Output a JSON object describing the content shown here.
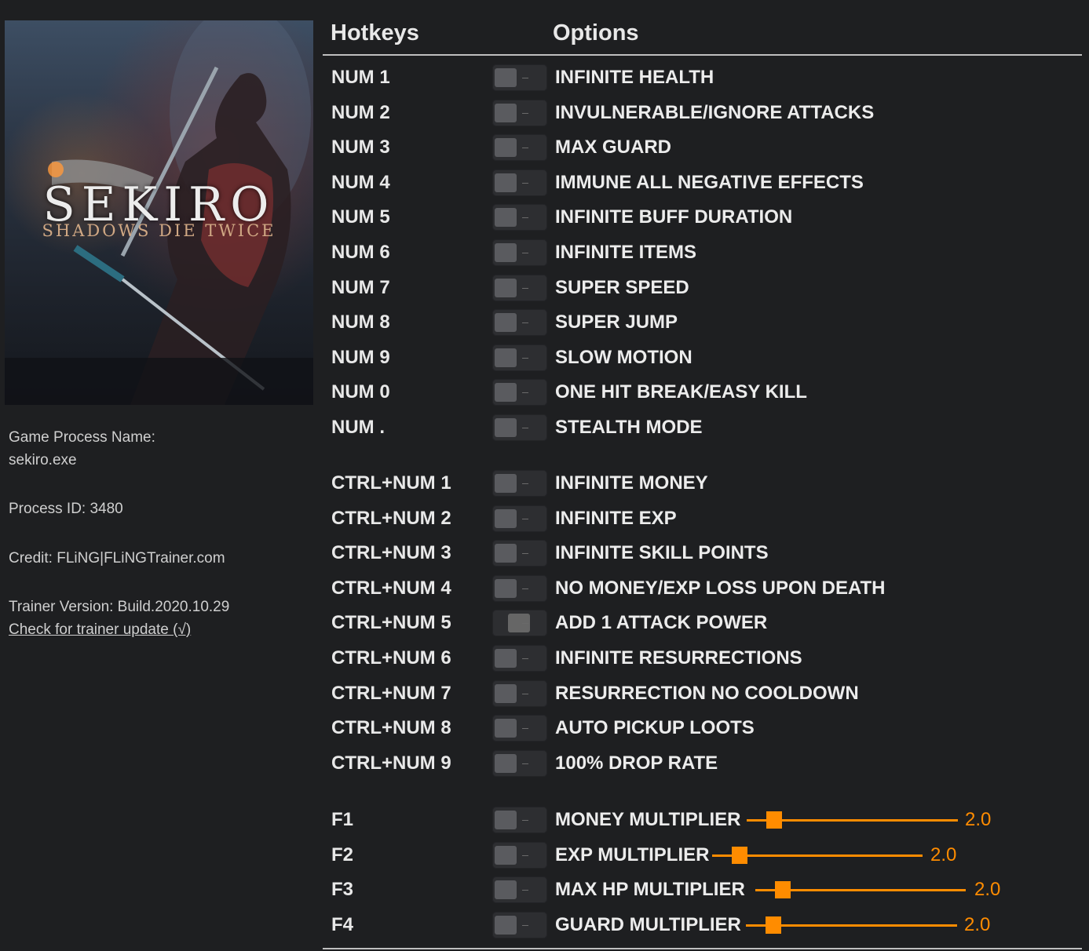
{
  "cover": {
    "title": "SEKIRO",
    "subtitle": "SHADOWS DIE TWICE"
  },
  "info": {
    "process_name_label": "Game Process Name:",
    "process_name": "sekiro.exe",
    "process_id": "Process ID: 3480",
    "credit": "Credit: FLiNG|FLiNGTrainer.com",
    "version": "Trainer Version: Build.2020.10.29",
    "update_link": "Check for trainer update (√)"
  },
  "header": {
    "hotkeys": "Hotkeys",
    "options": "Options"
  },
  "rows": [
    {
      "hotkey": "NUM 1",
      "option": "INFINITE HEALTH",
      "state": "off"
    },
    {
      "hotkey": "NUM 2",
      "option": "INVULNERABLE/IGNORE ATTACKS",
      "state": "off"
    },
    {
      "hotkey": "NUM 3",
      "option": "MAX GUARD",
      "state": "off"
    },
    {
      "hotkey": "NUM 4",
      "option": "IMMUNE ALL NEGATIVE EFFECTS",
      "state": "off"
    },
    {
      "hotkey": "NUM 5",
      "option": "INFINITE BUFF DURATION",
      "state": "off"
    },
    {
      "hotkey": "NUM 6",
      "option": "INFINITE ITEMS",
      "state": "off"
    },
    {
      "hotkey": "NUM 7",
      "option": "SUPER SPEED",
      "state": "off"
    },
    {
      "hotkey": "NUM 8",
      "option": "SUPER JUMP",
      "state": "off"
    },
    {
      "hotkey": "NUM 9",
      "option": "SLOW MOTION",
      "state": "off"
    },
    {
      "hotkey": "NUM 0",
      "option": "ONE HIT BREAK/EASY KILL",
      "state": "off"
    },
    {
      "hotkey": "NUM .",
      "option": "STEALTH MODE",
      "state": "off"
    },
    {
      "hotkey": "CTRL+NUM 1",
      "option": "INFINITE MONEY",
      "state": "off"
    },
    {
      "hotkey": "CTRL+NUM 2",
      "option": "INFINITE EXP",
      "state": "off"
    },
    {
      "hotkey": "CTRL+NUM 3",
      "option": "INFINITE SKILL POINTS",
      "state": "off"
    },
    {
      "hotkey": "CTRL+NUM 4",
      "option": "NO MONEY/EXP LOSS UPON DEATH",
      "state": "off"
    },
    {
      "hotkey": "CTRL+NUM 5",
      "option": "ADD 1 ATTACK POWER",
      "state": "pressed"
    },
    {
      "hotkey": "CTRL+NUM 6",
      "option": "INFINITE RESURRECTIONS",
      "state": "off"
    },
    {
      "hotkey": "CTRL+NUM 7",
      "option": "RESURRECTION NO COOLDOWN",
      "state": "off"
    },
    {
      "hotkey": "CTRL+NUM 8",
      "option": "AUTO PICKUP LOOTS",
      "state": "off"
    },
    {
      "hotkey": "CTRL+NUM 9",
      "option": "100% DROP RATE",
      "state": "off"
    },
    {
      "hotkey": "F1",
      "option": "MONEY MULTIPLIER",
      "state": "off",
      "slider": "2.0",
      "slider_fraction": 0.1
    },
    {
      "hotkey": "F2",
      "option": "EXP MULTIPLIER",
      "state": "off",
      "slider": "2.0",
      "slider_fraction": 0.1
    },
    {
      "hotkey": "F3",
      "option": "MAX HP MULTIPLIER",
      "state": "off",
      "slider": "2.0",
      "slider_fraction": 0.1
    },
    {
      "hotkey": "F4",
      "option": "GUARD MULTIPLIER",
      "state": "off",
      "slider": "2.0",
      "slider_fraction": 0.1
    }
  ],
  "colors": {
    "accent": "#ff8c00",
    "background": "#1e1f21"
  }
}
